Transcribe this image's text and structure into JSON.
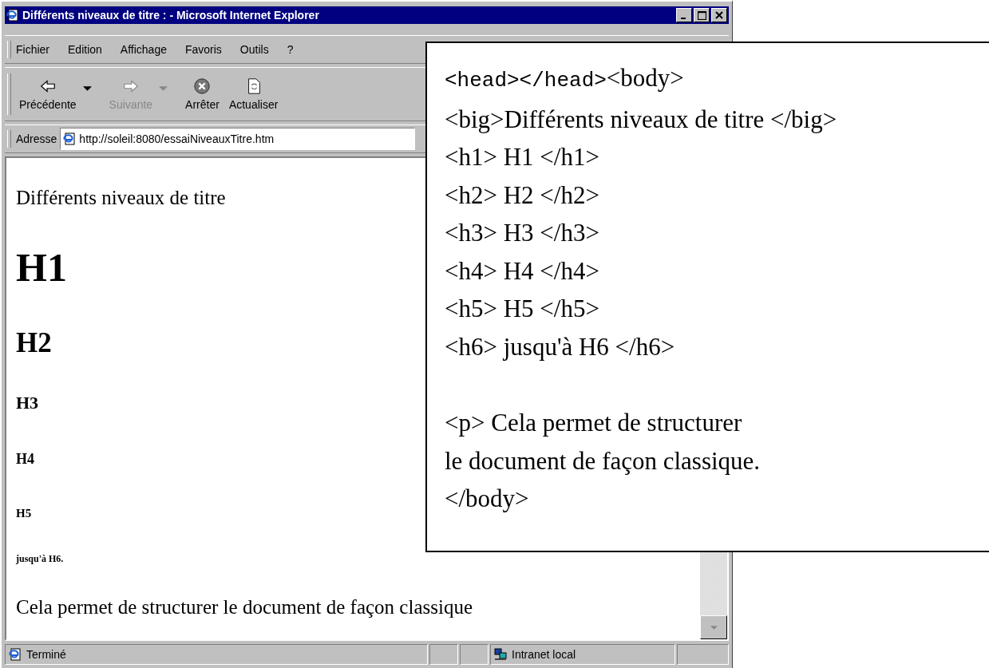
{
  "window": {
    "title": "Différents niveaux de titre : - Microsoft Internet Explorer"
  },
  "menu": [
    "Fichier",
    "Edition",
    "Affichage",
    "Favoris",
    "Outils",
    "?"
  ],
  "toolbar": [
    {
      "label": "Précédente",
      "kind": "back",
      "disabled": false
    },
    {
      "label": "Suivante",
      "kind": "forward",
      "disabled": true
    },
    {
      "label": "Arrêter",
      "kind": "stop",
      "disabled": false
    },
    {
      "label": "Actualiser",
      "kind": "refresh",
      "disabled": false
    }
  ],
  "address": {
    "label": "Adresse",
    "value": "http://soleil:8080/essaiNiveauxTitre.htm"
  },
  "content": [
    {
      "kind": "big",
      "text": "Différents niveaux de titre"
    },
    {
      "kind": "h1",
      "text": "H1"
    },
    {
      "kind": "h2",
      "text": "H2"
    },
    {
      "kind": "h3",
      "text": "H3"
    },
    {
      "kind": "h4",
      "text": "H4"
    },
    {
      "kind": "h5",
      "text": "H5"
    },
    {
      "kind": "h6",
      "text": "jusqu'à H6."
    },
    {
      "kind": "p",
      "text": "Cela permet de structurer le document de façon classique"
    }
  ],
  "status_bar": {
    "text": "Terminé",
    "zone": "Intranet local"
  },
  "code_box": {
    "blocks": [
      [
        [
          {
            "kind": "mono",
            "text": "<head></head>"
          },
          {
            "kind": "serif",
            "text": "<body>"
          }
        ],
        [
          {
            "kind": "serif",
            "text": "<big>Différents niveaux de titre </big>"
          }
        ],
        [
          {
            "kind": "serif",
            "text": "<h1> H1 </h1>"
          }
        ],
        [
          {
            "kind": "serif",
            "text": "<h2> H2 </h2>"
          }
        ],
        [
          {
            "kind": "serif",
            "text": "<h3> H3 </h3>"
          }
        ],
        [
          {
            "kind": "serif",
            "text": "<h4> H4 </h4>"
          }
        ],
        [
          {
            "kind": "serif",
            "text": "<h5> H5 </h5>"
          }
        ],
        [
          {
            "kind": "serif",
            "text": "<h6> jusqu'à H6 </h6>"
          }
        ]
      ],
      [
        [
          {
            "kind": "serif",
            "text": "<p> Cela permet de structurer"
          }
        ],
        [
          {
            "kind": "serif",
            "text": "le document de façon classique."
          }
        ],
        [
          {
            "kind": "serif",
            "text": "</body>"
          }
        ]
      ]
    ]
  }
}
